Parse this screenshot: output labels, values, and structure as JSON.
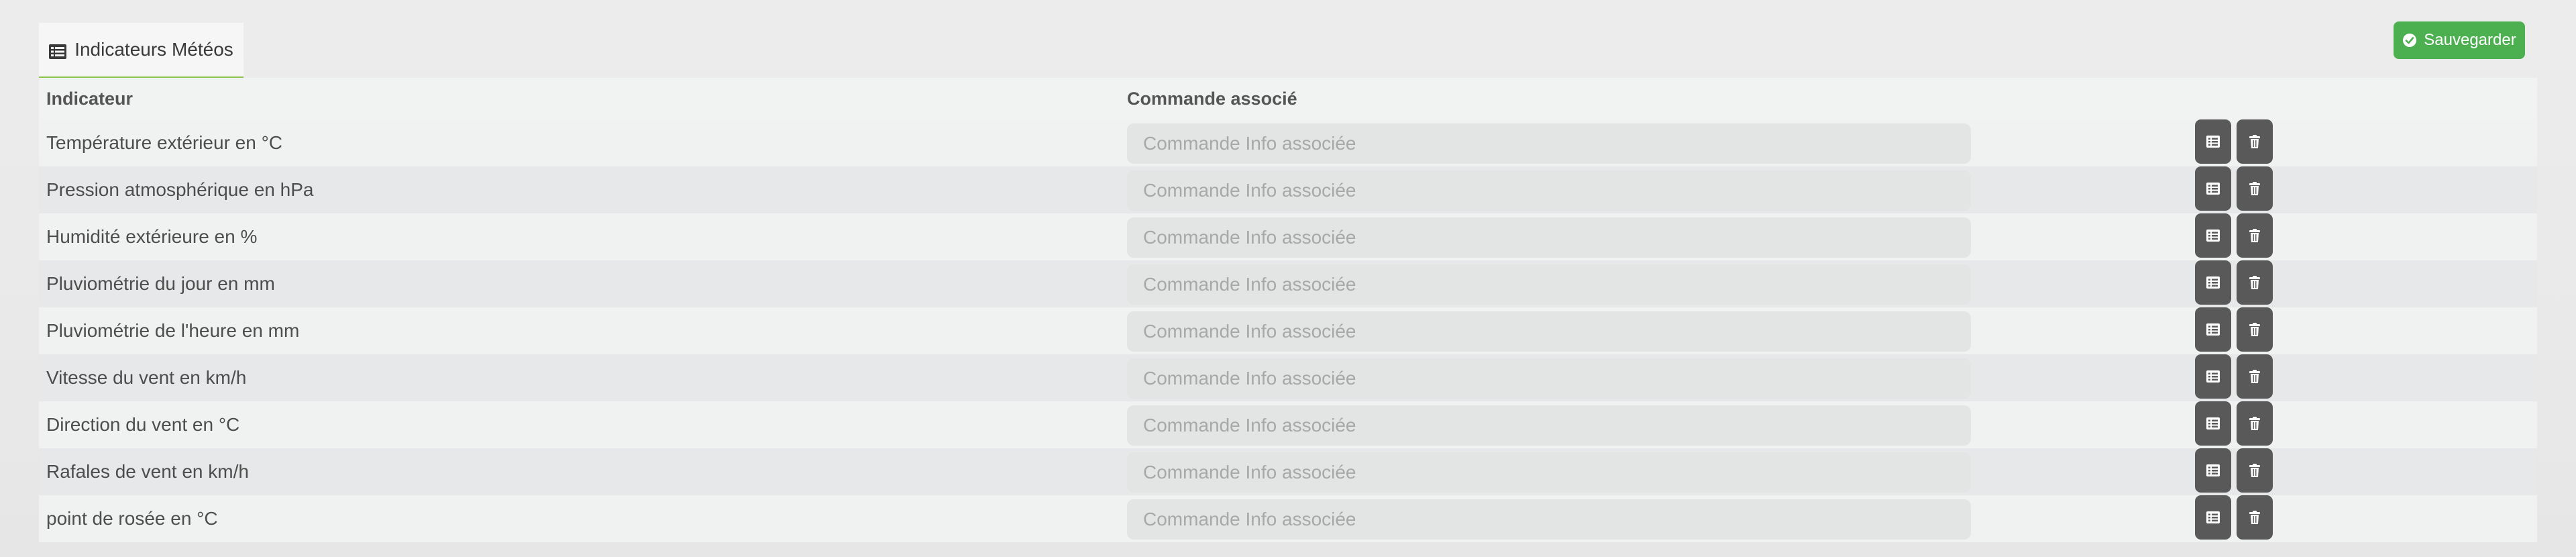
{
  "tab": {
    "label": "Indicateurs Météos",
    "icon": "list-icon"
  },
  "save_button": {
    "label": "Sauvegarder",
    "icon": "check-circle-icon",
    "color": "#4caf50"
  },
  "table": {
    "headers": {
      "indicator": "Indicateur",
      "command": "Commande associé"
    },
    "input_placeholder": "Commande Info associée",
    "rows": [
      {
        "label": "Température extérieur en °C",
        "value": ""
      },
      {
        "label": "Pression atmosphérique en hPa",
        "value": ""
      },
      {
        "label": "Humidité extérieure en %",
        "value": ""
      },
      {
        "label": "Pluviométrie du jour en mm",
        "value": ""
      },
      {
        "label": "Pluviométrie de l'heure en mm",
        "value": ""
      },
      {
        "label": "Vitesse du vent en km/h",
        "value": ""
      },
      {
        "label": "Direction du vent en °C",
        "value": ""
      },
      {
        "label": "Rafales de vent en km/h",
        "value": ""
      },
      {
        "label": "point de rosée en °C",
        "value": ""
      }
    ],
    "row_actions": [
      {
        "icon": "list-icon"
      },
      {
        "icon": "trash-icon"
      }
    ]
  }
}
